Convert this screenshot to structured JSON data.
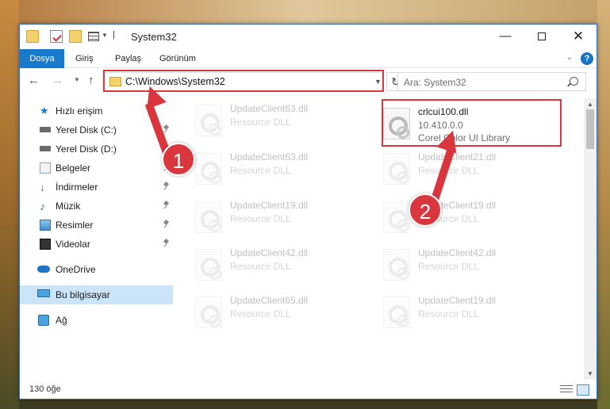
{
  "window": {
    "title": "System32",
    "controls": {
      "minimize": "—",
      "close": "✕"
    }
  },
  "ribbon": {
    "tabs": [
      "Dosya",
      "Giriş",
      "Paylaş",
      "Görünüm"
    ],
    "help": "?"
  },
  "navigation": {
    "address": "C:\\Windows\\System32",
    "search_placeholder": "Ara: System32"
  },
  "sidebar": {
    "items": [
      {
        "label": "Hızlı erişim",
        "icon": "star-icon"
      },
      {
        "label": "Yerel Disk (C:)",
        "icon": "disk-icon",
        "pinned": true
      },
      {
        "label": "Yerel Disk (D:)",
        "icon": "disk-icon",
        "pinned": true
      },
      {
        "label": "Belgeler",
        "icon": "documents-icon",
        "pinned": true
      },
      {
        "label": "İndirmeler",
        "icon": "download-icon",
        "pinned": true
      },
      {
        "label": "Müzik",
        "icon": "music-icon",
        "pinned": true
      },
      {
        "label": "Resimler",
        "icon": "pictures-icon",
        "pinned": true
      },
      {
        "label": "Videolar",
        "icon": "video-icon",
        "pinned": true
      },
      {
        "label": "OneDrive",
        "icon": "cloud-icon"
      },
      {
        "label": "Bu bilgisayar",
        "icon": "computer-icon",
        "selected": true
      },
      {
        "label": "Ağ",
        "icon": "network-icon"
      }
    ]
  },
  "files": {
    "highlighted": {
      "name": "crlcui100.dll",
      "version": "10.410.0.0",
      "description": "Corel Color UI Library"
    },
    "left_column": [
      {
        "name": "UpdateClient63.dll",
        "type": "Resource DLL"
      },
      {
        "name": "UpdateClient63.dll",
        "type": "Resource DLL"
      },
      {
        "name": "UpdateClient19.dll",
        "type": "Resource DLL"
      },
      {
        "name": "UpdateClient42.dll",
        "type": "Resource DLL"
      },
      {
        "name": "UpdateClient65.dll",
        "type": "Resource DLL"
      }
    ],
    "right_column": [
      {
        "name": "UpdateClient21.dll",
        "type": "Resource DLL"
      },
      {
        "name": "UpdateClient19.dll",
        "type": "Resource DLL"
      },
      {
        "name": "UpdateClient42.dll",
        "type": "Resource DLL"
      },
      {
        "name": "UpdateClient19.dll",
        "type": "Resource DLL"
      }
    ]
  },
  "status": {
    "count": "130 öğe"
  },
  "annotations": {
    "step1": "1",
    "step2": "2",
    "color": "#d9363e"
  }
}
